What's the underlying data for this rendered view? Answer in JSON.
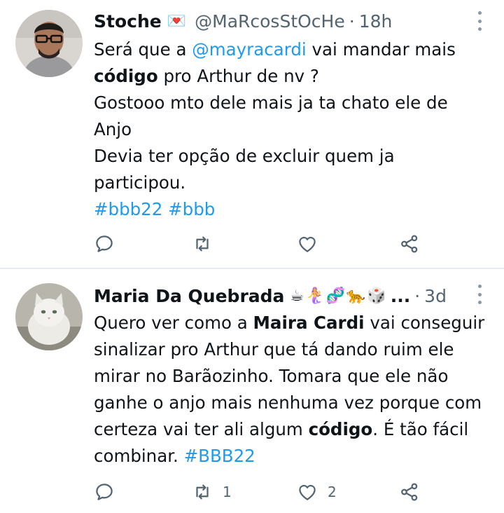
{
  "tweets": [
    {
      "display_name": "Stoche",
      "name_emoji": "💌",
      "handle": "@MaRcosStOcHe",
      "separator": "·",
      "time": "18h",
      "lines": [
        {
          "a": "Será que a ",
          "mention": "@mayracardi",
          "b": " vai mandar mais"
        },
        {
          "bold": "código",
          "rest": " pro Arthur de nv ?"
        },
        {
          "text": "Gostooo mto dele mais ja ta chato ele de"
        },
        {
          "text": "Anjo"
        },
        {
          "text": "Devia ter opção de excluir quem ja"
        },
        {
          "text": "participou."
        },
        {
          "tag1": "#bbb22",
          "space": " ",
          "tag2": "#bbb"
        }
      ],
      "actions": {
        "reply_count": "",
        "retweet_count": "",
        "like_count": ""
      }
    },
    {
      "display_name": "Maria Da Quebrada",
      "name_emoji": "☕🧜‍♀️🧬🐆🎲",
      "ellipsis": "...",
      "separator": "·",
      "time": "3d",
      "lines": [
        {
          "a": "Quero ver como a ",
          "bold": "Maira Cardi",
          "b": " vai conseguir"
        },
        {
          "text": "sinalizar pro Arthur que tá dando ruim ele"
        },
        {
          "text": "mirar no Barãozinho. Tomara que ele não"
        },
        {
          "text": "ganhe o anjo mais nenhuma vez porque com"
        },
        {
          "a": "certeza vai ter ali algum ",
          "bold": "código",
          "b": ". É tão fácil"
        },
        {
          "a": "combinar. ",
          "tag": "#BBB22"
        }
      ],
      "actions": {
        "reply_count": "",
        "retweet_count": "1",
        "like_count": "2"
      }
    }
  ],
  "icons": {
    "reply": "reply-icon",
    "retweet": "retweet-icon",
    "like": "heart-icon",
    "share": "share-icon",
    "more": "more-options-icon"
  },
  "colors": {
    "link": "#1d9bf0",
    "secondary_text": "#536471",
    "primary_text": "#0f1419",
    "divider": "#e6ecf0"
  }
}
